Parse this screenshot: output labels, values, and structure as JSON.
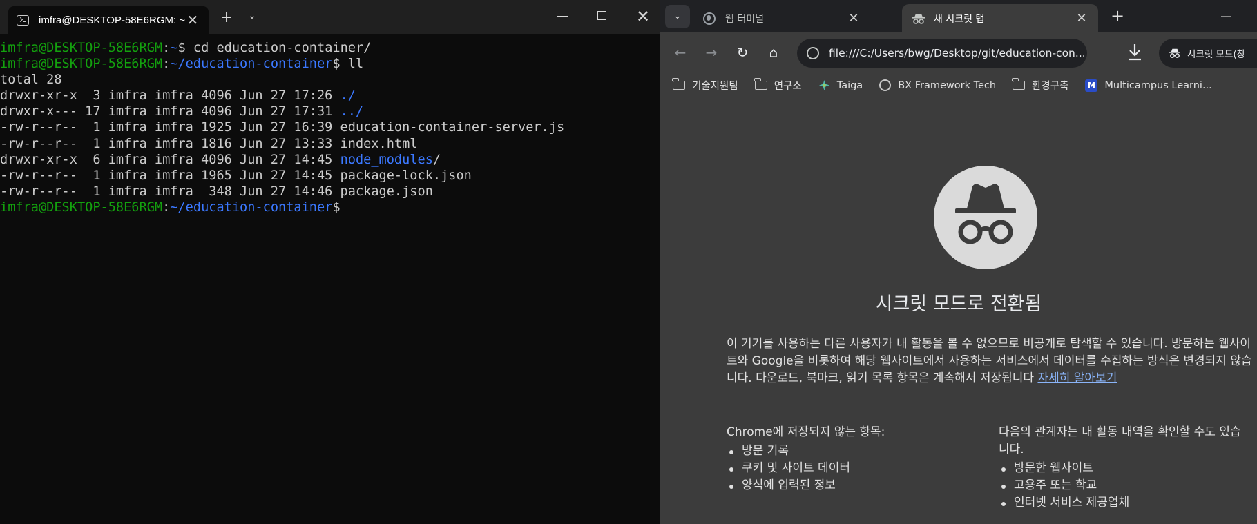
{
  "terminal": {
    "tab_title": "imfra@DESKTOP-58E6RGM: ~",
    "controls": {
      "new_tab": "+",
      "dropdown": "⌄",
      "close": "✕",
      "tab_close": "✕"
    },
    "prompt_user_host": "imfra@DESKTOP-58E6RGM",
    "lines": [
      {
        "segments": [
          {
            "text": "imfra@DESKTOP-58E6RGM",
            "color": "green"
          },
          {
            "text": ":",
            "color": "white"
          },
          {
            "text": "~",
            "color": "blue"
          },
          {
            "text": "$ cd education-container/",
            "color": "white"
          }
        ]
      },
      {
        "segments": [
          {
            "text": "imfra@DESKTOP-58E6RGM",
            "color": "green"
          },
          {
            "text": ":",
            "color": "white"
          },
          {
            "text": "~/education-container",
            "color": "blue"
          },
          {
            "text": "$ ll",
            "color": "white"
          }
        ]
      },
      {
        "segments": [
          {
            "text": "total 28",
            "color": "white"
          }
        ]
      },
      {
        "segments": [
          {
            "text": "drwxr-xr-x  3 imfra imfra 4096 Jun 27 17:26 ",
            "color": "white"
          },
          {
            "text": "./",
            "color": "blue"
          }
        ]
      },
      {
        "segments": [
          {
            "text": "drwxr-x--- 17 imfra imfra 4096 Jun 27 17:31 ",
            "color": "white"
          },
          {
            "text": "../",
            "color": "blue"
          }
        ]
      },
      {
        "segments": [
          {
            "text": "-rw-r--r--  1 imfra imfra 1925 Jun 27 16:39 education-container-server.js",
            "color": "white"
          }
        ]
      },
      {
        "segments": [
          {
            "text": "-rw-r--r--  1 imfra imfra 1816 Jun 27 13:33 index.html",
            "color": "white"
          }
        ]
      },
      {
        "segments": [
          {
            "text": "drwxr-xr-x  6 imfra imfra 4096 Jun 27 14:45 ",
            "color": "white"
          },
          {
            "text": "node_modules",
            "color": "blue"
          },
          {
            "text": "/",
            "color": "white"
          }
        ]
      },
      {
        "segments": [
          {
            "text": "-rw-r--r--  1 imfra imfra 1965 Jun 27 14:45 package-lock.json",
            "color": "white"
          }
        ]
      },
      {
        "segments": [
          {
            "text": "-rw-r--r--  1 imfra imfra  348 Jun 27 14:46 package.json",
            "color": "white"
          }
        ]
      },
      {
        "segments": [
          {
            "text": "imfra@DESKTOP-58E6RGM",
            "color": "green"
          },
          {
            "text": ":",
            "color": "white"
          },
          {
            "text": "~/education-container",
            "color": "blue"
          },
          {
            "text": "$",
            "color": "white"
          }
        ]
      }
    ],
    "colors": {
      "green": "#13a10e",
      "blue": "#3b78ff",
      "white": "#cccccc",
      "background": "#0c0c0c"
    }
  },
  "chrome": {
    "tabs": [
      {
        "title": "웹 터미널",
        "icon": "globe-icon",
        "active": false
      },
      {
        "title": "새 시크릿 탭",
        "icon": "incognito-icon",
        "active": true
      }
    ],
    "tab_close": "✕",
    "new_tab": "+",
    "tab_search": "⌄",
    "nav": {
      "back": "←",
      "forward": "→",
      "reload": "↻",
      "home": "⌂"
    },
    "url": "file:///C:/Users/bwg/Desktop/git/education-con...",
    "incognito_label": "시크릿 모드(창",
    "bookmarks": [
      {
        "label": "기술지원팀",
        "icon": "folder-icon"
      },
      {
        "label": "연구소",
        "icon": "folder-icon"
      },
      {
        "label": "Taiga",
        "icon": "taiga-icon"
      },
      {
        "label": "BX Framework Tech",
        "icon": "globe-icon"
      },
      {
        "label": "환경구축",
        "icon": "folder-icon"
      },
      {
        "label": "Multicampus Learni...",
        "icon": "multicampus-icon"
      }
    ],
    "page": {
      "title": "시크릿 모드로 전환됨",
      "paragraph": "이 기기를 사용하는 다른 사용자가 내 활동을 볼 수 없으므로 비공개로 탐색할 수 있습니다. 방문하는 웹사이트와 Google을 비롯하여 해당 웹사이트에서 사용하는 서비스에서 데이터를 수집하는 방식은 변경되지 않습니다. 다운로드, 북마크, 읽기 목록 항목은 계속해서 저장됩니다 ",
      "learn_more": "자세히 알아보기",
      "not_saved_heading": "Chrome에 저장되지 않는 항목:",
      "not_saved_items": [
        "방문 기록",
        "쿠키 및 사이트 데이터",
        "양식에 입력된 정보"
      ],
      "visible_heading": "다음의 관계자는 내 활동 내역을 확인할 수도 있습니다.",
      "visible_items": [
        "방문한 웹사이트",
        "고용주 또는 학교",
        "인터넷 서비스 제공업체"
      ]
    },
    "colors": {
      "background": "#3c3c3c",
      "tabstrip": "#202124",
      "link": "#8ab4f8"
    }
  }
}
